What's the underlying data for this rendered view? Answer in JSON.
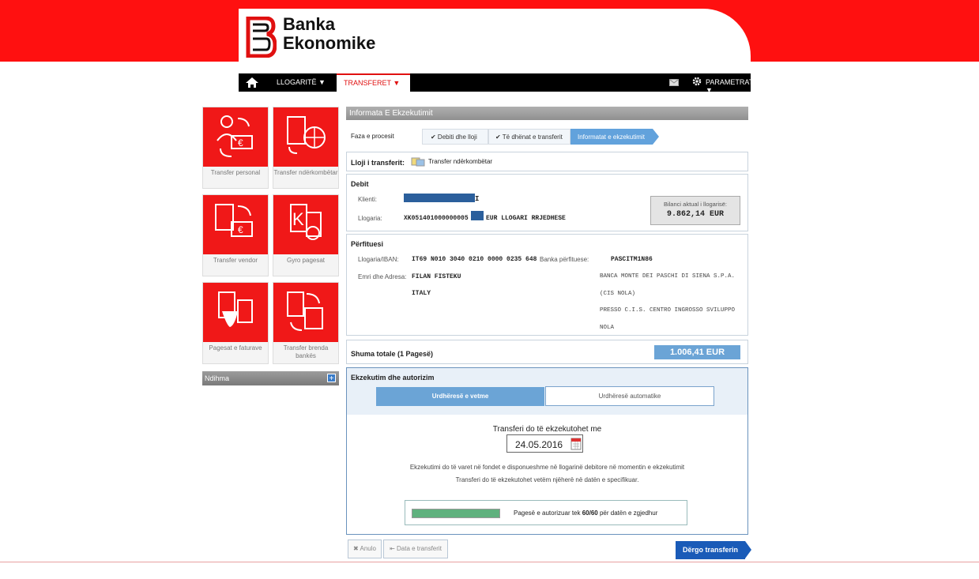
{
  "brand": {
    "line1": "Banka",
    "line2": "Ekonomike",
    "color": "#ff1010"
  },
  "nav": {
    "home_icon": "home-icon",
    "accounts": "LLOGARITË ▼",
    "transfers": "TRANSFERET ▼",
    "mail_icon": "envelope-icon",
    "settings_icon": "gear-icon",
    "settings": "PARAMETRAT ▼"
  },
  "sidebar": {
    "tiles": [
      {
        "label": "Transfer personal",
        "icon": "person-transfer-icon"
      },
      {
        "label": "Transfer ndërkombëtar",
        "icon": "international-transfer-icon"
      },
      {
        "label": "Transfer vendor",
        "icon": "domestic-transfer-icon"
      },
      {
        "label": "Gyro pagesat",
        "icon": "giro-payment-icon"
      },
      {
        "label": "Pagesat e faturave",
        "icon": "bill-payment-icon"
      },
      {
        "label": "Transfer brenda bankës",
        "icon": "internal-transfer-icon"
      }
    ],
    "help": {
      "label": "Ndihma",
      "plus": "+"
    }
  },
  "main": {
    "title": "Informata E Ekzekutimit",
    "phase_label": "Faza e procesit",
    "steps": [
      "✔ Debiti dhe lloji",
      "✔ Të dhënat e transferit",
      "Informatat e ekzekutimit"
    ],
    "transfer_type": {
      "label": "Lloji i transferit:",
      "value": "Transfer ndërkombëtar"
    },
    "debit": {
      "title": "Debit",
      "client_label": "Klienti:",
      "client_value": "I",
      "account_label": "Llogaria:",
      "account_value": "XK051401000000005",
      "account_suffix": "EUR LLOGARI RRJEDHESE",
      "balance_label": "Bilanci aktual i llogarisë:",
      "balance_value": "9.862,14 EUR"
    },
    "beneficiary": {
      "title": "Përfituesi",
      "iban_label": "Llogaria/IBAN:",
      "iban_value": "IT69 N010 3040 0210 0000 0235 648",
      "name_label": "Emri dhe Adresa:",
      "name_value": "FILAN FISTEKU",
      "country": "ITALY",
      "bank_label": "Banka përfituese:",
      "bank_code": "PASCITM1N86",
      "bank_lines": [
        "BANCA MONTE DEI PASCHI DI SIENA S.P.A.",
        "(CIS NOLA)",
        "PRESSO C.I.S. CENTRO INGROSSO SVILUPPO",
        "NOLA"
      ]
    },
    "total": {
      "label": "Shuma totale (1 Pagesë)",
      "value": "1.006,41 EUR"
    },
    "execution": {
      "title": "Ekzekutim dhe autorizim",
      "tab_single": "Urdhëresë e vetme",
      "tab_auto": "Urdhëresë automatike",
      "date_prompt": "Transferi do të ekzekutohet me",
      "date_value": "24.05.2016",
      "calendar_icon": "calendar-icon",
      "note1": "Ekzekutimi do të varet në fondet e disponueshme në llogarinë debitore në momentin e ekzekutimit",
      "note2": "Transferi do të ekzekutohet vetëm njëherë në datën e specifikuar.",
      "auth_prefix": "Pagesë e autorizuar tek ",
      "auth_count": "60/60",
      "auth_suffix": " për datën e zgjedhur",
      "auth_progress": 1.0
    },
    "buttons": {
      "cancel": "✖ Anulo",
      "back": "⇤ Data e transferit",
      "send": "Dërgo transferin"
    }
  }
}
